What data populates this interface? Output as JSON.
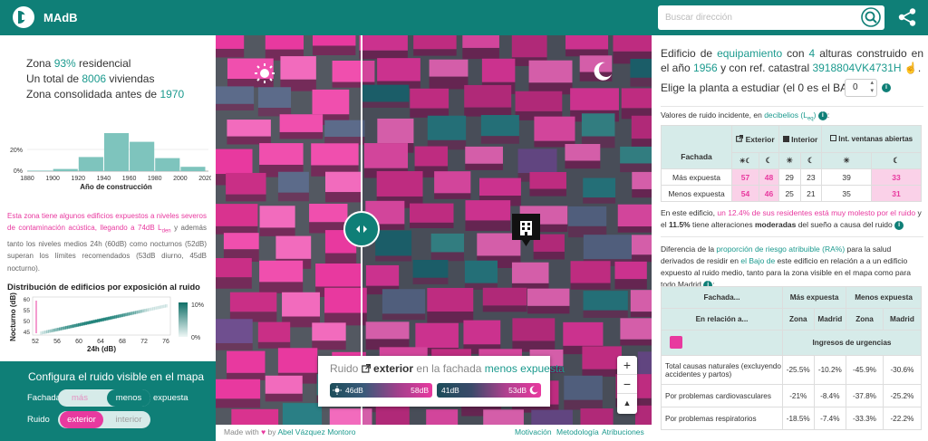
{
  "header": {
    "app_title": "MAdB",
    "search_placeholder": "Buscar dirección"
  },
  "summary": {
    "line1_pre": "Zona ",
    "line1_val": "93%",
    "line1_post": " residencial",
    "line2_pre": "Un total de ",
    "line2_val": "8006",
    "line2_post": " viviendas",
    "line3_pre": "Zona consolidada antes de ",
    "line3_val": "1970"
  },
  "chart_data": [
    {
      "type": "bar",
      "xlabel": "Año de construcción",
      "categories": [
        "1880",
        "1900",
        "1920",
        "1940",
        "1960",
        "1980",
        "2000",
        "2020"
      ],
      "y_ticks": [
        "0%",
        "20%"
      ],
      "bins": [
        {
          "from": 1880,
          "to": 1900,
          "value": 0.5
        },
        {
          "from": 1900,
          "to": 1920,
          "value": 2
        },
        {
          "from": 1920,
          "to": 1940,
          "value": 13
        },
        {
          "from": 1940,
          "to": 1960,
          "value": 35
        },
        {
          "from": 1960,
          "to": 1980,
          "value": 27
        },
        {
          "from": 1980,
          "to": 2000,
          "value": 12
        },
        {
          "from": 2000,
          "to": 2020,
          "value": 4
        }
      ],
      "ylim": [
        0,
        40
      ]
    },
    {
      "type": "heatmap",
      "title": "Distribución de edificios por exposición al ruido",
      "xlabel": "24h (dB)",
      "ylabel": "Nocturno (dB)",
      "x_ticks": [
        "52",
        "56",
        "60",
        "64",
        "68",
        "72",
        "76"
      ],
      "y_ticks": [
        "45",
        "50",
        "55",
        "60"
      ],
      "scale_labels": [
        "10%",
        "0%"
      ]
    }
  ],
  "note": {
    "text1": "Esta zona tiene algunos edificios expuestos a niveles severos de contaminación acústica, llegando a 74dB L",
    "sub1": "den",
    "text2": " y además tanto los niveles medios 24h (60dB) como nocturnos (52dB) superan los límites recomendados (53dB diurno, 45dB nocturno)."
  },
  "config": {
    "title": "Configura el ruido visible en el mapa",
    "facade_label": "Fachada",
    "facade_opt_a": "más",
    "facade_opt_b": "menos",
    "facade_suffix": "expuesta",
    "noise_label": "Ruido",
    "noise_opt_a": "exterior",
    "noise_opt_b": "interior"
  },
  "map": {
    "legend_pre": "Ruido ",
    "legend_mode": "exterior",
    "legend_mid": " en la fachada ",
    "legend_facade": "menos expuesta",
    "day_min": "46dB",
    "day_max": "58dB",
    "night_min": "41dB",
    "night_max": "53dB",
    "zoom_in": "+",
    "zoom_out": "−",
    "compass": "▲"
  },
  "footer": {
    "made_with": "Made with",
    "by": "by",
    "author": "Abel Vázquez Montoro",
    "link1": "Motivación",
    "link2": "Metodología",
    "link3": "Atribuciones"
  },
  "building": {
    "d1": "Edificio de ",
    "use": "equipamiento",
    "d2": " con ",
    "floors": "4",
    "d3": " alturas construido en el año ",
    "year": "1956",
    "d4": " y con ref. catastral ",
    "ref": "3918804VK4731H",
    "d5": ".",
    "floor_prompt": "Elige la planta a estudiar (el 0 es el BAJO):",
    "floor_value": "0"
  },
  "noise_values": {
    "intro": "Valores de ruido incidente, en ",
    "unit": "decibelios (L",
    "unit_sub": "eq",
    "unit_close": ")",
    "colon": ":",
    "col_ext": "Exterior",
    "col_int": "Interior",
    "col_win": "Int. ventanas abiertas",
    "row_head": "Fachada",
    "rows": [
      {
        "label": "Más expuesta",
        "v": [
          "57",
          "48",
          "29",
          "23",
          "39",
          "33"
        ]
      },
      {
        "label": "Menos expuesta",
        "v": [
          "54",
          "46",
          "25",
          "21",
          "35",
          "31"
        ]
      }
    ]
  },
  "residents": {
    "t1": "En este edificio, ",
    "p1": "un 12.4% de sus residentes está muy molesto por el ruido",
    "t2": " y el ",
    "v2": "11.5%",
    "t3": " tiene alteraciones ",
    "b3": "moderadas",
    "t4": " del sueño a causa del ruido"
  },
  "risk": {
    "t1": "Diferencia de la ",
    "link": "proporción de riesgo atribuible (RA%)",
    "t2": " para la salud derivados de residir en ",
    "link2": "el Bajo de",
    "t3": " este edificio en relación a a un edificio expuesto al ruido medio, tanto para la zona visible en el mapa como para todo Madrid",
    "colon": ":",
    "h_facade": "Fachada...",
    "h_rel": "En relación a...",
    "h_more": "Más expuesta",
    "h_less": "Menos expuesta",
    "h_zona": "Zona",
    "h_madrid": "Madrid",
    "section": "Ingresos de urgencias",
    "rows": [
      {
        "label": "Total causas naturales (excluyendo accidentes y partos)",
        "v": [
          "-25.5%",
          "-10.2%",
          "-45.9%",
          "-30.6%"
        ]
      },
      {
        "label": "Por problemas cardiovasculares",
        "v": [
          "-21%",
          "-8.4%",
          "-37.8%",
          "-25.2%"
        ]
      },
      {
        "label": "Por problemas respiratorios",
        "v": [
          "-18.5%",
          "-7.4%",
          "-33.3%",
          "-22.2%"
        ]
      }
    ]
  },
  "colors": {
    "brand": "#0f7f77",
    "accent_pink": "#e8399f",
    "link_teal": "#1b9a8e"
  },
  "icons": [
    "logo-icon",
    "search-icon",
    "share-icon",
    "sun-icon",
    "moon-icon",
    "compare-handle-icon",
    "building-marker-icon",
    "open-external-icon",
    "info-icon"
  ]
}
